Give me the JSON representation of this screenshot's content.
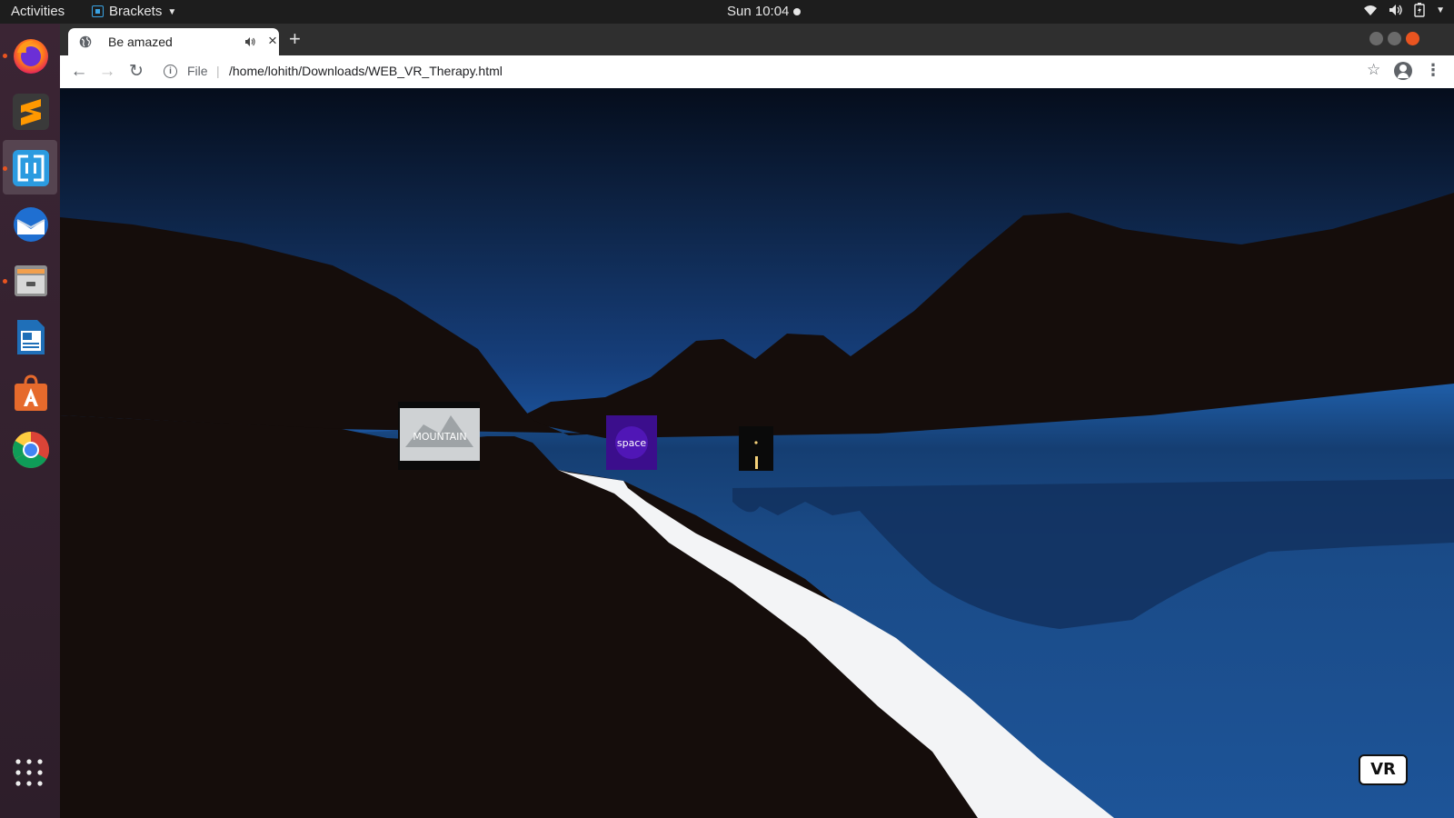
{
  "topbar": {
    "activities": "Activities",
    "app_name": "Brackets",
    "clock": "Sun 10:04"
  },
  "dock": {
    "items": [
      {
        "name": "Firefox",
        "icon": "firefox-icon"
      },
      {
        "name": "Sublime Text",
        "icon": "sublime-icon"
      },
      {
        "name": "Brackets",
        "icon": "brackets-icon"
      },
      {
        "name": "Thunderbird",
        "icon": "thunderbird-icon"
      },
      {
        "name": "Files",
        "icon": "files-icon"
      },
      {
        "name": "LibreOffice Writer",
        "icon": "writer-icon"
      },
      {
        "name": "Ubuntu Software",
        "icon": "software-icon"
      },
      {
        "name": "Chrome",
        "icon": "chrome-icon"
      }
    ],
    "apps_grid": "show-applications-icon"
  },
  "browser": {
    "tab_title": "Be amazed",
    "new_tab": "+",
    "address": {
      "scheme_label": "File",
      "separator": "|",
      "url": "/home/lohith/Downloads/WEB_VR_Therapy.html"
    }
  },
  "scene": {
    "panels": [
      {
        "name": "mountain-video-panel",
        "label": "MOUNTAIN"
      },
      {
        "name": "space-video-panel",
        "label": "space"
      },
      {
        "name": "night-video-panel",
        "label": ""
      }
    ],
    "vr_button": "VR"
  },
  "colors": {
    "sky_top": "#050d1c",
    "sky_horizon": "#1d5aa6",
    "terrain": "#150d0b",
    "lake": "#1b4d8c",
    "path": "#f3f4f6",
    "accent_dock_dot": "#e95420"
  }
}
